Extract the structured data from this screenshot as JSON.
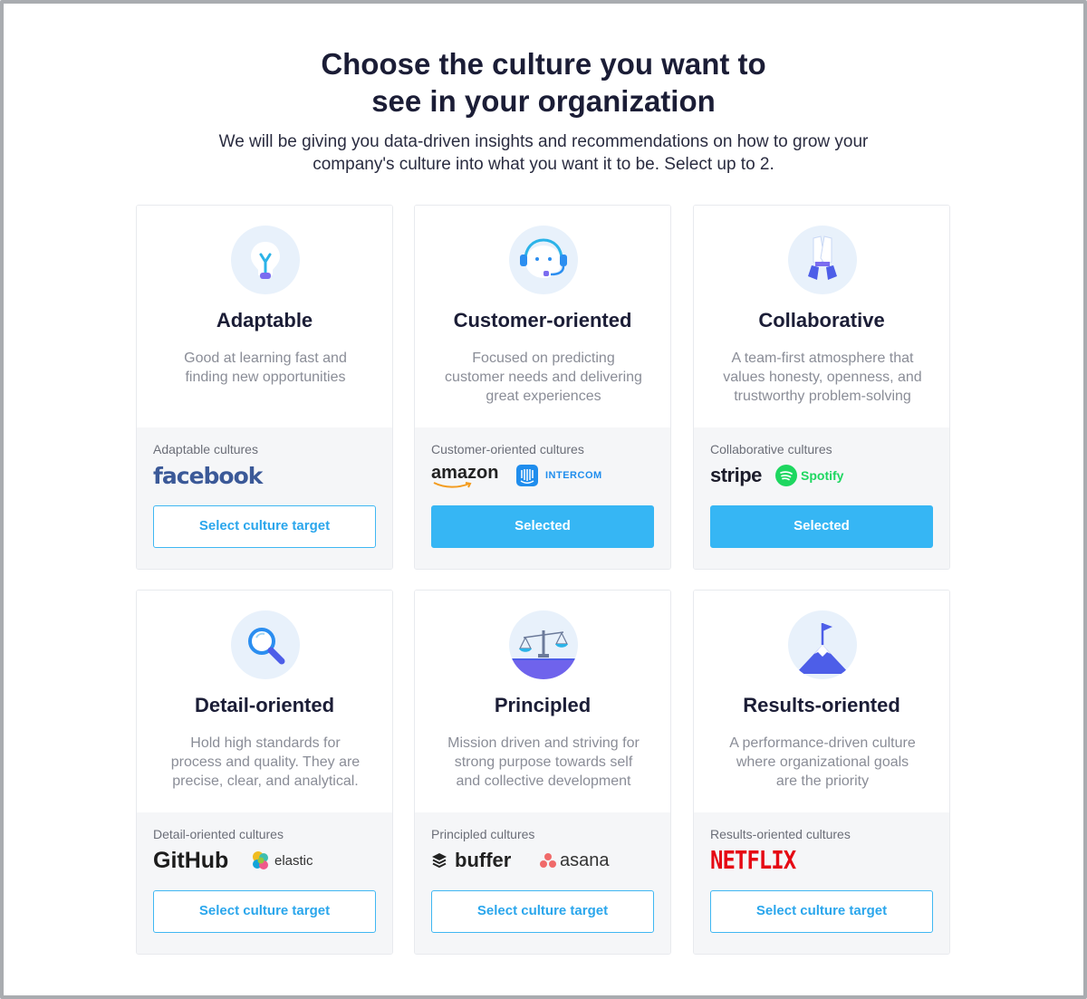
{
  "heading": {
    "line1": "Choose the culture you want to",
    "line2": "see in your organization"
  },
  "subheading": {
    "line1": "We will be giving you data-driven insights and recommendations on how to grow your",
    "line2": "company's culture into what you want it to be. Select up to 2."
  },
  "colors": {
    "accent": "#36b6f4",
    "title": "#1b1d36",
    "muted": "#8a8d97",
    "icon_bg": "#e8f1fb"
  },
  "cards": [
    {
      "icon": "lightbulb-icon",
      "title": "Adaptable",
      "desc": [
        "Good at learning fast and",
        "finding new opportunities"
      ],
      "examples_label": "Adaptable cultures",
      "logos": [
        "facebook"
      ],
      "button": "Select culture target",
      "selected": false
    },
    {
      "icon": "headset-icon",
      "title": "Customer-oriented",
      "desc": [
        "Focused on predicting",
        "customer needs and delivering",
        "great experiences"
      ],
      "examples_label": "Customer-oriented cultures",
      "logos": [
        "amazon",
        "INTERCOM"
      ],
      "button": "Selected",
      "selected": true
    },
    {
      "icon": "high-five-icon",
      "title": "Collaborative",
      "desc": [
        "A team-first atmosphere that",
        "values honesty, openness, and",
        "trustworthy problem-solving"
      ],
      "examples_label": "Collaborative cultures",
      "logos": [
        "stripe",
        "Spotify"
      ],
      "button": "Selected",
      "selected": true
    },
    {
      "icon": "magnifier-icon",
      "title": "Detail-oriented",
      "desc": [
        "Hold high standards for",
        "process and quality. They are",
        "precise, clear, and analytical."
      ],
      "examples_label": "Detail-oriented cultures",
      "logos": [
        "GitHub",
        "elastic"
      ],
      "button": "Select culture target",
      "selected": false
    },
    {
      "icon": "scales-icon",
      "title": "Principled",
      "desc": [
        "Mission driven and striving for",
        "strong purpose towards self",
        "and collective development"
      ],
      "examples_label": "Principled cultures",
      "logos": [
        "buffer",
        "asana"
      ],
      "button": "Select culture target",
      "selected": false
    },
    {
      "icon": "mountain-flag-icon",
      "title": "Results-oriented",
      "desc": [
        "A performance-driven culture",
        "where organizational goals",
        "are the priority"
      ],
      "examples_label": "Results-oriented cultures",
      "logos": [
        "NETFLIX"
      ],
      "button": "Select culture target",
      "selected": false
    }
  ]
}
